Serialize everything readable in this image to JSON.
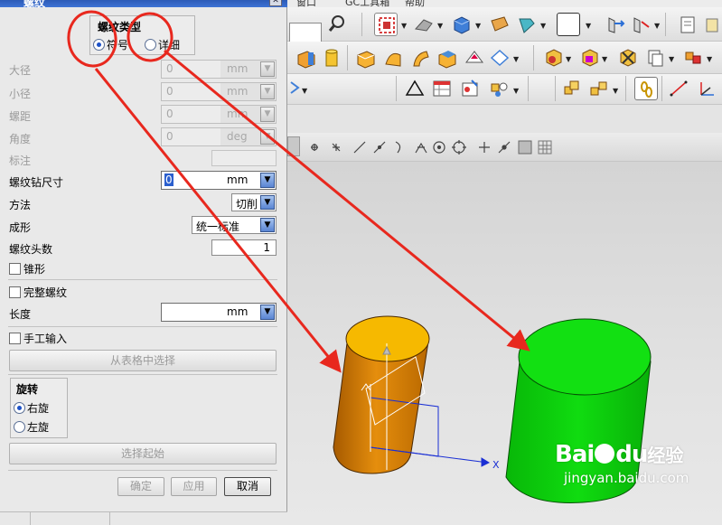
{
  "dialog": {
    "title": "螺纹",
    "close_glyph": "✕",
    "thread_type": {
      "title": "螺纹类型",
      "options": [
        {
          "label": "符号",
          "selected": true
        },
        {
          "label": "详细",
          "selected": false
        }
      ]
    },
    "rows": {
      "major_dia": {
        "label": "大径",
        "value": "0",
        "unit": "mm"
      },
      "minor_dia": {
        "label": "小径",
        "value": "0",
        "unit": "mm"
      },
      "pitch": {
        "label": "螺距",
        "value": "0",
        "unit": "mm"
      },
      "angle": {
        "label": "角度",
        "value": "0",
        "unit": "deg"
      },
      "callout": {
        "label": "标注"
      },
      "tap_drill": {
        "label": "螺纹钻尺寸",
        "value": "0",
        "unit": "mm"
      },
      "method": {
        "label": "方法",
        "value": "切削"
      },
      "form": {
        "label": "成形",
        "value": "统一标准"
      },
      "starts": {
        "label": "螺纹头数",
        "value": "1"
      },
      "length": {
        "label": "长度",
        "unit": "mm"
      }
    },
    "checkboxes": {
      "tapered": "锥形",
      "full_thread": "完整螺纹",
      "manual_input": "手工输入"
    },
    "choose_from_table": "从表格中选择",
    "rotation": {
      "title": "旋转",
      "options": [
        {
          "label": "右旋",
          "selected": true
        },
        {
          "label": "左旋",
          "selected": false
        }
      ]
    },
    "select_start": "选择起始",
    "buttons": {
      "ok": "确定",
      "apply": "应用",
      "cancel": "取消"
    }
  },
  "menu_partial": {
    "item1": "窗口",
    "item2": "GC工具箱",
    "item3": "帮助"
  },
  "viewport": {
    "axis_label": "X"
  },
  "watermark": {
    "brand": "Bai",
    "brand2": "du",
    "cn": "经验",
    "url": "jingyan.baidu.com"
  },
  "colors": {
    "orange_cylinder": "#d4830a",
    "orange_top": "#f5b400",
    "green_cylinder": "#0bd00b",
    "annotation_red": "#e8281e",
    "axis_blue": "#1a2fd4"
  }
}
